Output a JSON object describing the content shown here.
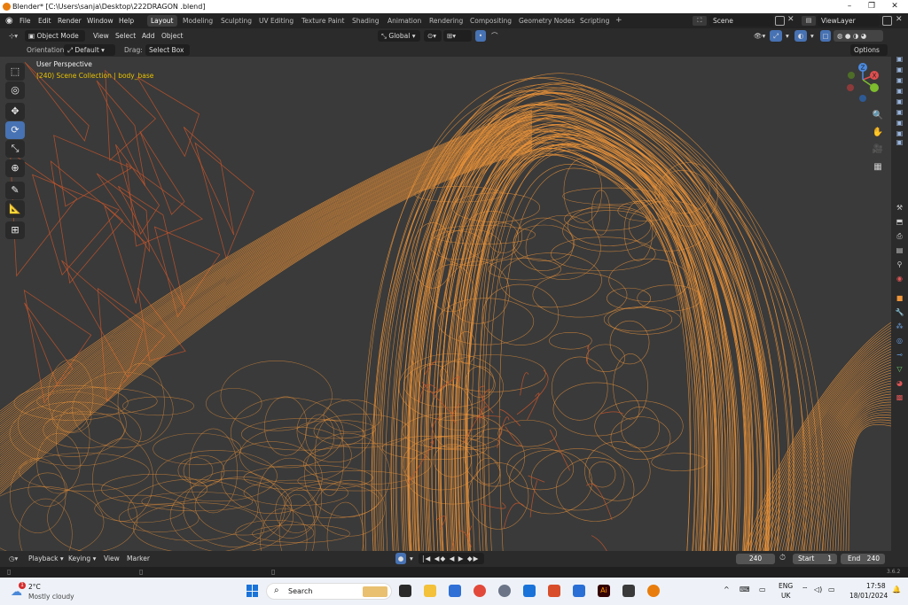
{
  "window": {
    "title": "Blender* [C:\\Users\\sanja\\Desktop\\222DRAGON .blend]",
    "controls": [
      "–",
      "❐",
      "✕"
    ]
  },
  "menubar": {
    "menus": [
      "File",
      "Edit",
      "Render",
      "Window",
      "Help"
    ],
    "workspaces": [
      "Layout",
      "Modeling",
      "Sculpting",
      "UV Editing",
      "Texture Paint",
      "Shading",
      "Animation",
      "Rendering",
      "Compositing",
      "Geometry Nodes",
      "Scripting"
    ],
    "active_workspace": "Layout",
    "add_tab": "+",
    "scene": "Scene",
    "view_layer": "ViewLayer"
  },
  "header3d": {
    "mode": "Object Mode",
    "menus": [
      "View",
      "Select",
      "Add",
      "Object"
    ],
    "transform_orientation": "Global"
  },
  "toolheader": {
    "orientation_label": "Orientation:",
    "orientation_value": "Default",
    "drag_label": "Drag:",
    "drag_value": "Select Box",
    "options_label": "Options"
  },
  "viewport": {
    "perspective_label": "User Perspective",
    "collection_label": "(240) Scene Collection | body_base",
    "gizmo_axes": [
      "X",
      "Y",
      "Z"
    ],
    "colors": {
      "background": "#3a3a3a",
      "wire_selected": "#f0963a",
      "wire_other": "#c8552a",
      "text_yellow": "#e8c200"
    }
  },
  "timeline": {
    "menus": [
      "Playback",
      "Keying",
      "View",
      "Marker"
    ],
    "current_frame": "240",
    "start_label": "Start",
    "start_value": "1",
    "end_label": "End",
    "end_value": "240",
    "version": "3.6.2"
  },
  "taskbar": {
    "weather_temp": "2°C",
    "weather_desc": "Mostly cloudy",
    "weather_badge": "1",
    "search_placeholder": "Search",
    "lang_top": "ENG",
    "lang_bottom": "UK",
    "time": "17:58",
    "date": "18/01/2024"
  }
}
